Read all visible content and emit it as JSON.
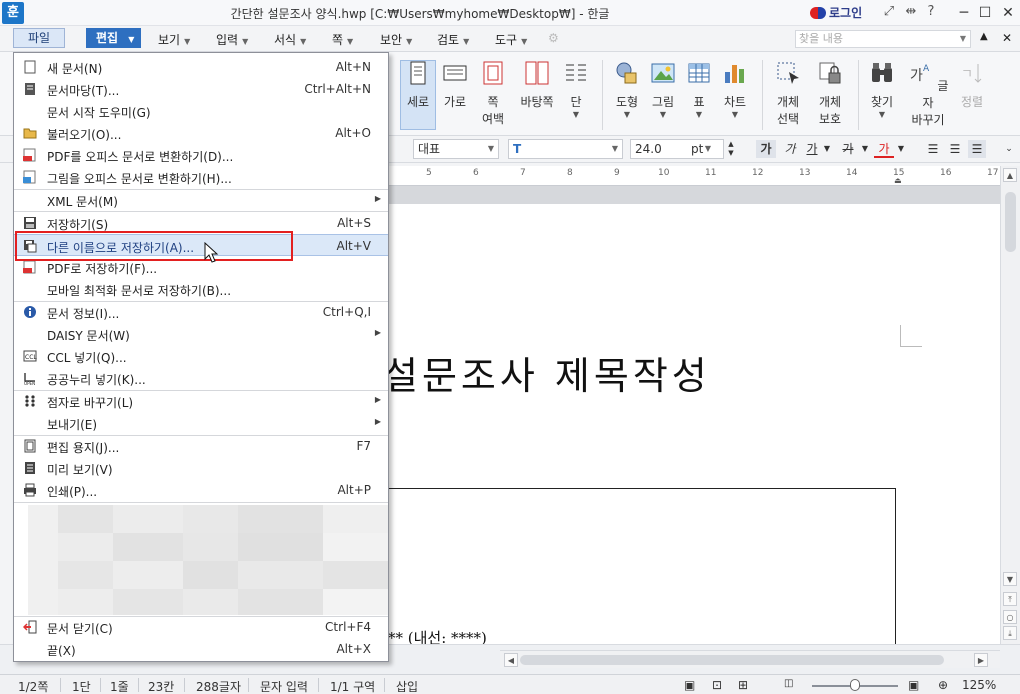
{
  "window": {
    "title": "간단한 설문조사 양식.hwp [C:₩Users₩myhome₩Desktop₩] - 한글",
    "app_icon_label": "훈",
    "login_label": "로그인",
    "minimize": "─",
    "maximize": "☐",
    "close": "✕"
  },
  "menubar": {
    "file": "파일",
    "edit": "편집",
    "items": [
      "보기",
      "입력",
      "서식",
      "쪽",
      "보안",
      "검토",
      "도구"
    ],
    "search_placeholder": "찾을 내용"
  },
  "ribbon": {
    "buttons": [
      {
        "label": "세로",
        "sub": ""
      },
      {
        "label": "가로",
        "sub": ""
      },
      {
        "label": "쪽",
        "sub": "여백"
      },
      {
        "label": "바탕쪽",
        "sub": ""
      },
      {
        "label": "단",
        "sub": ""
      },
      {
        "label": "도형",
        "sub": ""
      },
      {
        "label": "그림",
        "sub": ""
      },
      {
        "label": "표",
        "sub": ""
      },
      {
        "label": "차트",
        "sub": ""
      },
      {
        "label": "개체",
        "sub": "선택"
      },
      {
        "label": "개체",
        "sub": "보호"
      },
      {
        "label": "찾기",
        "sub": ""
      },
      {
        "label": "글자",
        "sub": "바꾸기"
      },
      {
        "label": "정렬",
        "sub": ""
      }
    ]
  },
  "formatbar": {
    "style": "대표",
    "font": "",
    "font_icon": "T",
    "size": "24.0",
    "unit": "pt",
    "bold": "가",
    "italic": "가",
    "underline": "가",
    "strike": "가",
    "color": "가"
  },
  "ruler": {
    "numbers": [
      "5",
      "6",
      "7",
      "8",
      "9",
      "10",
      "11",
      "12",
      "13",
      "14",
      "15",
      "16",
      "17"
    ]
  },
  "document": {
    "title": "설문조사 제목작성",
    "line": "** (내선: ****)"
  },
  "file_menu": {
    "items": [
      {
        "label": "새 문서(N)",
        "shortcut": "Alt+N",
        "icon": "new-doc-icon"
      },
      {
        "label": "문서마당(T)...",
        "shortcut": "Ctrl+Alt+N",
        "icon": "doc-template-icon"
      },
      {
        "label": "문서 시작 도우미(G)",
        "shortcut": "",
        "icon": ""
      },
      {
        "label": "불러오기(O)...",
        "shortcut": "Alt+O",
        "icon": "open-folder-icon"
      },
      {
        "label": "PDF를 오피스 문서로 변환하기(D)...",
        "shortcut": "",
        "icon": "pdf-icon"
      },
      {
        "label": "그림을 오피스 문서로 변환하기(H)...",
        "shortcut": "",
        "icon": "image-convert-icon"
      },
      {
        "label": "XML 문서(M)",
        "shortcut": "",
        "icon": ""
      },
      {
        "label": "저장하기(S)",
        "shortcut": "Alt+S",
        "icon": "save-icon"
      },
      {
        "label": "다른 이름으로 저장하기(A)...",
        "shortcut": "Alt+V",
        "icon": "save-as-icon"
      },
      {
        "label": "PDF로 저장하기(F)...",
        "shortcut": "",
        "icon": "pdf-save-icon"
      },
      {
        "label": "모바일 최적화 문서로 저장하기(B)...",
        "shortcut": "",
        "icon": ""
      },
      {
        "label": "문서 정보(I)...",
        "shortcut": "Ctrl+Q,I",
        "icon": "info-icon"
      },
      {
        "label": "DAISY 문서(W)",
        "shortcut": "",
        "icon": ""
      },
      {
        "label": "CCL 넣기(Q)...",
        "shortcut": "",
        "icon": "ccl-icon"
      },
      {
        "label": "공공누리 넣기(K)...",
        "shortcut": "",
        "icon": "open-license-icon"
      },
      {
        "label": "점자로 바꾸기(L)",
        "shortcut": "",
        "icon": "braille-icon"
      },
      {
        "label": "보내기(E)",
        "shortcut": "",
        "icon": ""
      },
      {
        "label": "편집 용지(J)...",
        "shortcut": "F7",
        "icon": "page-setup-icon"
      },
      {
        "label": "미리 보기(V)",
        "shortcut": "",
        "icon": "preview-icon"
      },
      {
        "label": "인쇄(P)...",
        "shortcut": "Alt+P",
        "icon": "print-icon"
      },
      {
        "label": "문서 닫기(C)",
        "shortcut": "Ctrl+F4",
        "icon": "close-doc-icon"
      },
      {
        "label": "끝(X)",
        "shortcut": "Alt+X",
        "icon": ""
      }
    ]
  },
  "statusbar": {
    "page": "1/2쪽",
    "section": "1단",
    "line": "1줄",
    "column": "23칸",
    "chars": "288글자",
    "mode": "문자 입력",
    "area": "1/1 구역",
    "insert": "삽입",
    "zoom": "125%"
  },
  "colors": {
    "accent": "#2e6fc0",
    "highlight_box": "#e32020",
    "menu_hover": "#dbe8f8"
  }
}
